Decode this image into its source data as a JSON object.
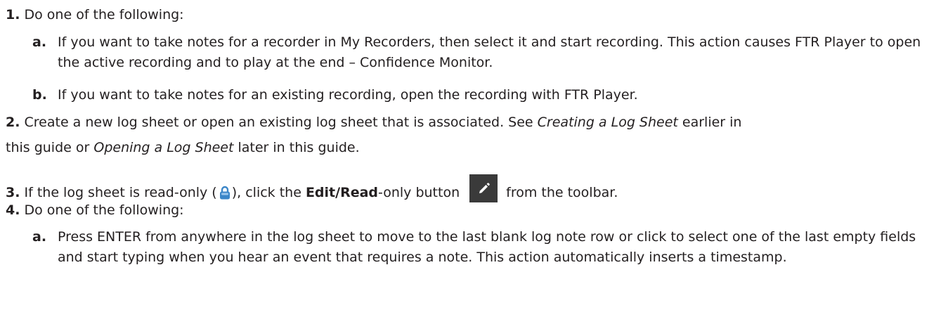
{
  "steps": [
    {
      "num": "1.",
      "text": "Do one of the following:"
    },
    {
      "num": "2.",
      "text_a": "Create a new log sheet or open an existing log sheet that is associated.  See ",
      "link_1": "Creating a Log Sheet",
      "text_b": " earlier in",
      "text_c": "this guide or ",
      "link_2": "Opening a Log Sheet",
      "text_d": " later in this guide."
    },
    {
      "num": "3.",
      "text_a": "If the log sheet is read-only (",
      "text_b": "), click the ",
      "bold": "Edit/Read",
      "text_c": "-only button",
      "text_d": "from the toolbar."
    },
    {
      "num": "4.",
      "text": "Do one of the following:"
    }
  ],
  "substeps_1": [
    {
      "letter": "a.",
      "text": "If you want to take notes for a recorder in My Recorders, then select it and start recording. This action causes FTR Player to open the active recording and to play at the end – Confidence Monitor."
    },
    {
      "letter": "b.",
      "text": "If you want to take notes for an existing recording, open the recording with FTR Player."
    }
  ],
  "substeps_4": [
    {
      "letter": "a.",
      "text": "Press ENTER from anywhere in the log sheet to move to the last blank log note row or click to select one of the last empty fields and start typing when you hear an event that requires a note.  This action automatically inserts a timestamp."
    }
  ],
  "icons": {
    "lock": "lock-icon",
    "edit": "pencil-edit-icon"
  },
  "colors": {
    "lock_blue": "#3b86c8",
    "edit_bg": "#3a3a3a"
  }
}
